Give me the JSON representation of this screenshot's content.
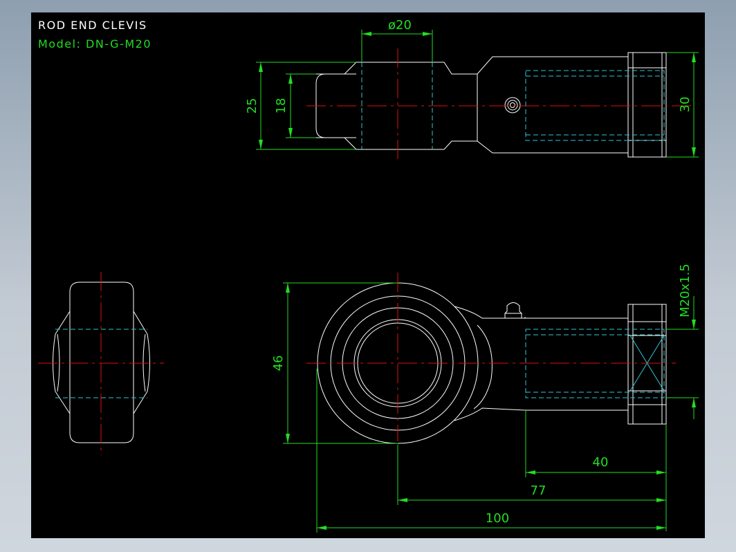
{
  "title": "ROD END CLEVIS",
  "model": "Model: DN-G-M20",
  "dimensions": {
    "pin_diameter": "ø20",
    "outer_height": "25",
    "inner_height": "18",
    "nut_height": "30",
    "thread_spec": "M20x1.5",
    "eye_height": "46",
    "thread_length": "40",
    "center_to_end": "77",
    "overall_length": "100"
  },
  "colors": {
    "background": "#000000",
    "outline": "#ffffff",
    "center_line": "#e01010",
    "hidden_line": "#2ec8d8",
    "dimension": "#22dd22"
  }
}
